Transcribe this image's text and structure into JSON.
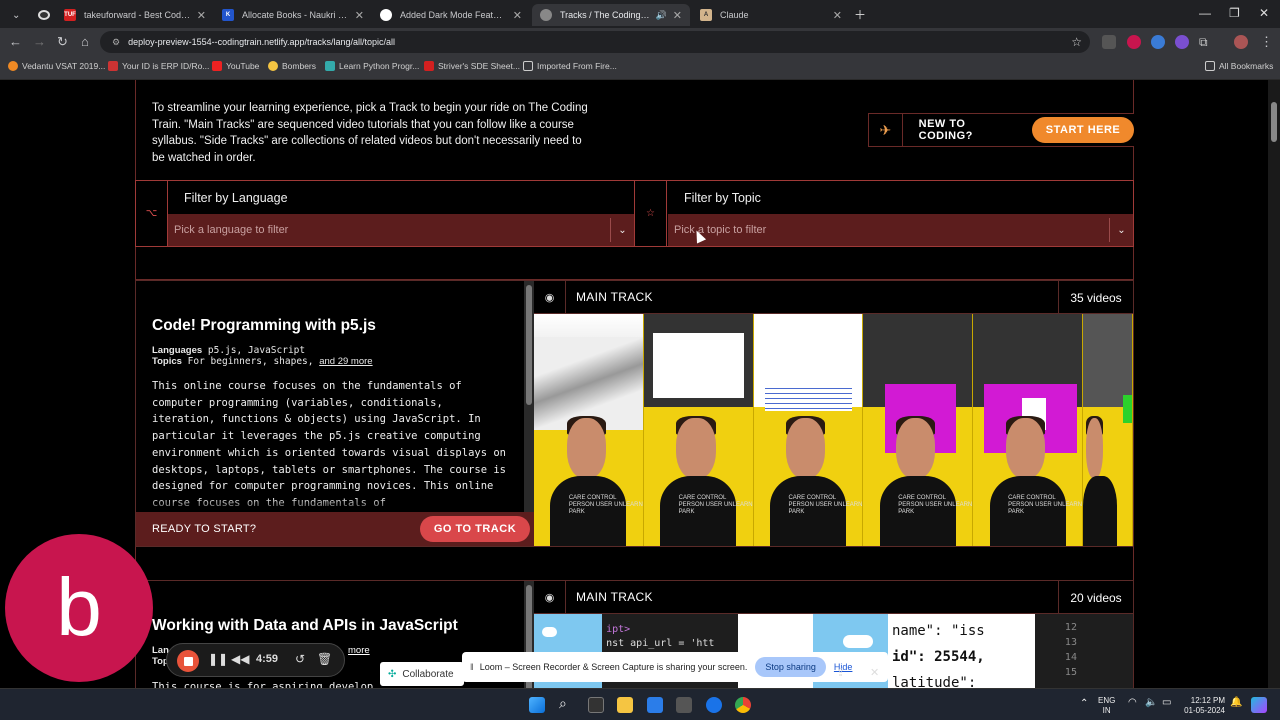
{
  "browser": {
    "tabs": [
      {
        "title": "",
        "favicon": "record-icon"
      },
      {
        "title": "takeuforward - Best Coding Tu",
        "favicon": "TUF"
      },
      {
        "title": "Allocate Books - Naukri Code 3",
        "favicon": "K"
      },
      {
        "title": "Added Dark Mode Feature to th",
        "favicon": "github-icon"
      },
      {
        "title": "Tracks / The Coding Train",
        "favicon": "train-icon"
      },
      {
        "title": "Claude",
        "favicon": "A"
      }
    ],
    "url": "deploy-preview-1554--codingtrain.netlify.app/tracks/lang/all/topic/all",
    "bookmarks": [
      "Vedantu VSAT 2019...",
      "Your ID is ERP ID/Ro...",
      "YouTube",
      "Bombers",
      "Learn Python Progr...",
      "Striver's SDE Sheet...",
      "Imported From Fire...",
      "All Bookmarks"
    ]
  },
  "intro": {
    "text": "To streamline your learning experience, pick a Track to begin your ride on The Coding Train. \"Main Tracks\" are sequenced video tutorials that you can follow like a course syllabus. \"Side Tracks\" are collections of related videos but don't necessarily need to be watched in order.",
    "new_to_coding": "NEW TO CODING?",
    "start_here": "START HERE"
  },
  "filters": {
    "language": {
      "heading": "Filter by Language",
      "placeholder": "Pick a language to filter"
    },
    "topic": {
      "heading": "Filter by Topic",
      "placeholder": "Pick a topic to filter"
    }
  },
  "tracks": [
    {
      "title": "Code! Programming with p5.js",
      "languages_label": "Languages",
      "languages": "p5.js, JavaScript",
      "topics_label": "Topics",
      "topics": "For beginners, shapes,",
      "more": "and 29 more",
      "description": "This online course focuses on the fundamentals of computer programming (variables, conditionals, iteration, functions & objects) using JavaScript. In particular it leverages the p5.js creative computing environment which is oriented towards visual displays on desktops, laptops, tablets or smartphones. The course is designed for computer programming novices. This online course focuses on the fundamentals of",
      "ready": "READY TO START?",
      "go": "GO TO TRACK",
      "kind": "MAIN TRACK",
      "count": "35 videos"
    },
    {
      "title": "Working with Data and APIs in JavaScript",
      "languages_label": "Lan",
      "topics_label": "Top",
      "more": "more",
      "description": "This course is for aspiring develop",
      "kind": "MAIN TRACK",
      "count": "20 videos",
      "code_lines": [
        "ipt>",
        "nst api_url = 'htt"
      ],
      "json_lines": [
        "name\": \"iss",
        "id\": 25544,",
        "latitude\":"
      ],
      "line_numbers": [
        "12",
        "13",
        "14",
        "15"
      ]
    }
  ],
  "shirt_text": "CARE CONTROL PERSON USER UNLEARN PARK",
  "loom": {
    "letter": "b",
    "timer": "4:59",
    "share_text": "Loom – Screen Recorder & Screen Capture is sharing your screen.",
    "stop": "Stop sharing",
    "hide": "Hide",
    "collaborate": "Collaborate"
  },
  "taskbar": {
    "lang": "ENG",
    "region": "IN",
    "time": "12:12 PM",
    "date": "01-05-2024"
  }
}
